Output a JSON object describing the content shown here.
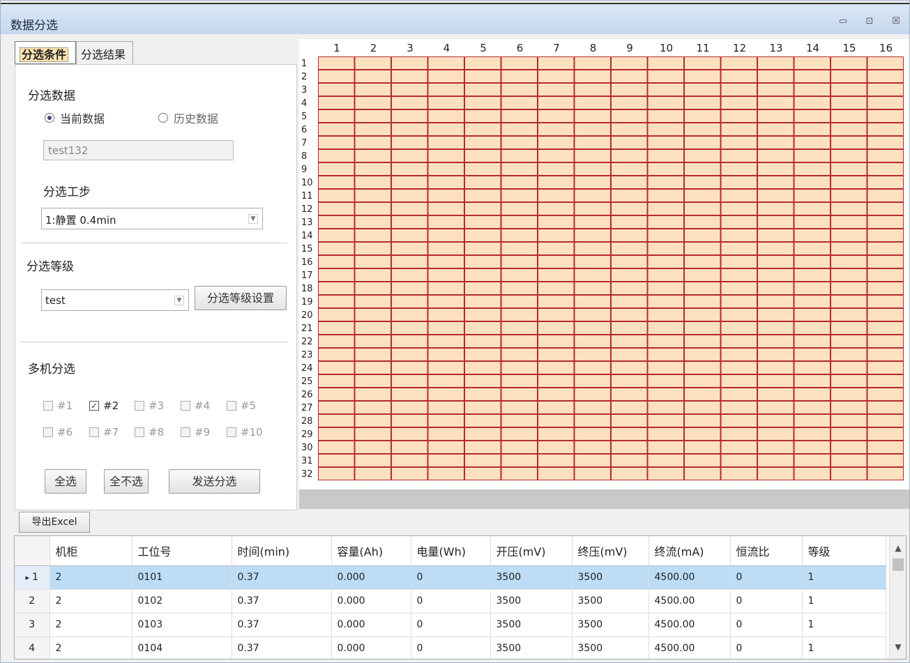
{
  "window": {
    "title": "数据分选",
    "minimize": "▭",
    "restore": "⊡",
    "close": "☒"
  },
  "tabs": [
    "分选条件",
    "分选结果"
  ],
  "left": {
    "section_data": "分选数据",
    "radio_current": "当前数据",
    "radio_history": "历史数据",
    "data_name_value": "test132",
    "section_step": "分选工步",
    "step_value": "1:静置 0.4min",
    "section_grade": "分选等级",
    "grade_value": "test",
    "grade_settings_button": "分选等级设置",
    "section_multi": "多机分选",
    "machines": [
      "#1",
      "#2",
      "#3",
      "#4",
      "#5",
      "#6",
      "#7",
      "#8",
      "#9",
      "#10"
    ],
    "checked_machine": "#2",
    "select_all": "全选",
    "select_none": "全不选",
    "send": "发送分选"
  },
  "grid": {
    "columns": [
      "1",
      "2",
      "3",
      "4",
      "5",
      "6",
      "7",
      "8",
      "9",
      "10",
      "11",
      "12",
      "13",
      "14",
      "15",
      "16"
    ],
    "rows": [
      "1",
      "2",
      "3",
      "4",
      "5",
      "6",
      "7",
      "8",
      "9",
      "10",
      "11",
      "12",
      "13",
      "14",
      "15",
      "16",
      "17",
      "18",
      "19",
      "20",
      "21",
      "22",
      "23",
      "24",
      "25",
      "26",
      "27",
      "28",
      "29",
      "30",
      "31",
      "32"
    ],
    "cell_color": "#fde0c0",
    "cell_border": "#b52a2a"
  },
  "export_button": "导出Excel",
  "table": {
    "headers": [
      "机柜",
      "工位号",
      "时间(min)",
      "容量(Ah)",
      "电量(Wh)",
      "开压(mV)",
      "终压(mV)",
      "终流(mA)",
      "恒流比",
      "等级"
    ],
    "rows": [
      {
        "index": "1",
        "cells": [
          "2",
          "0101",
          "0.37",
          "0.000",
          "0",
          "3500",
          "3500",
          "4500.00",
          "0",
          "1"
        ]
      },
      {
        "index": "2",
        "cells": [
          "2",
          "0102",
          "0.37",
          "0.000",
          "0",
          "3500",
          "3500",
          "4500.00",
          "0",
          "1"
        ]
      },
      {
        "index": "3",
        "cells": [
          "2",
          "0103",
          "0.37",
          "0.000",
          "0",
          "3500",
          "3500",
          "4500.00",
          "0",
          "1"
        ]
      },
      {
        "index": "4",
        "cells": [
          "2",
          "0104",
          "0.37",
          "0.000",
          "0",
          "3500",
          "3500",
          "4500.00",
          "0",
          "1"
        ]
      }
    ],
    "selected_marker": "▸"
  }
}
